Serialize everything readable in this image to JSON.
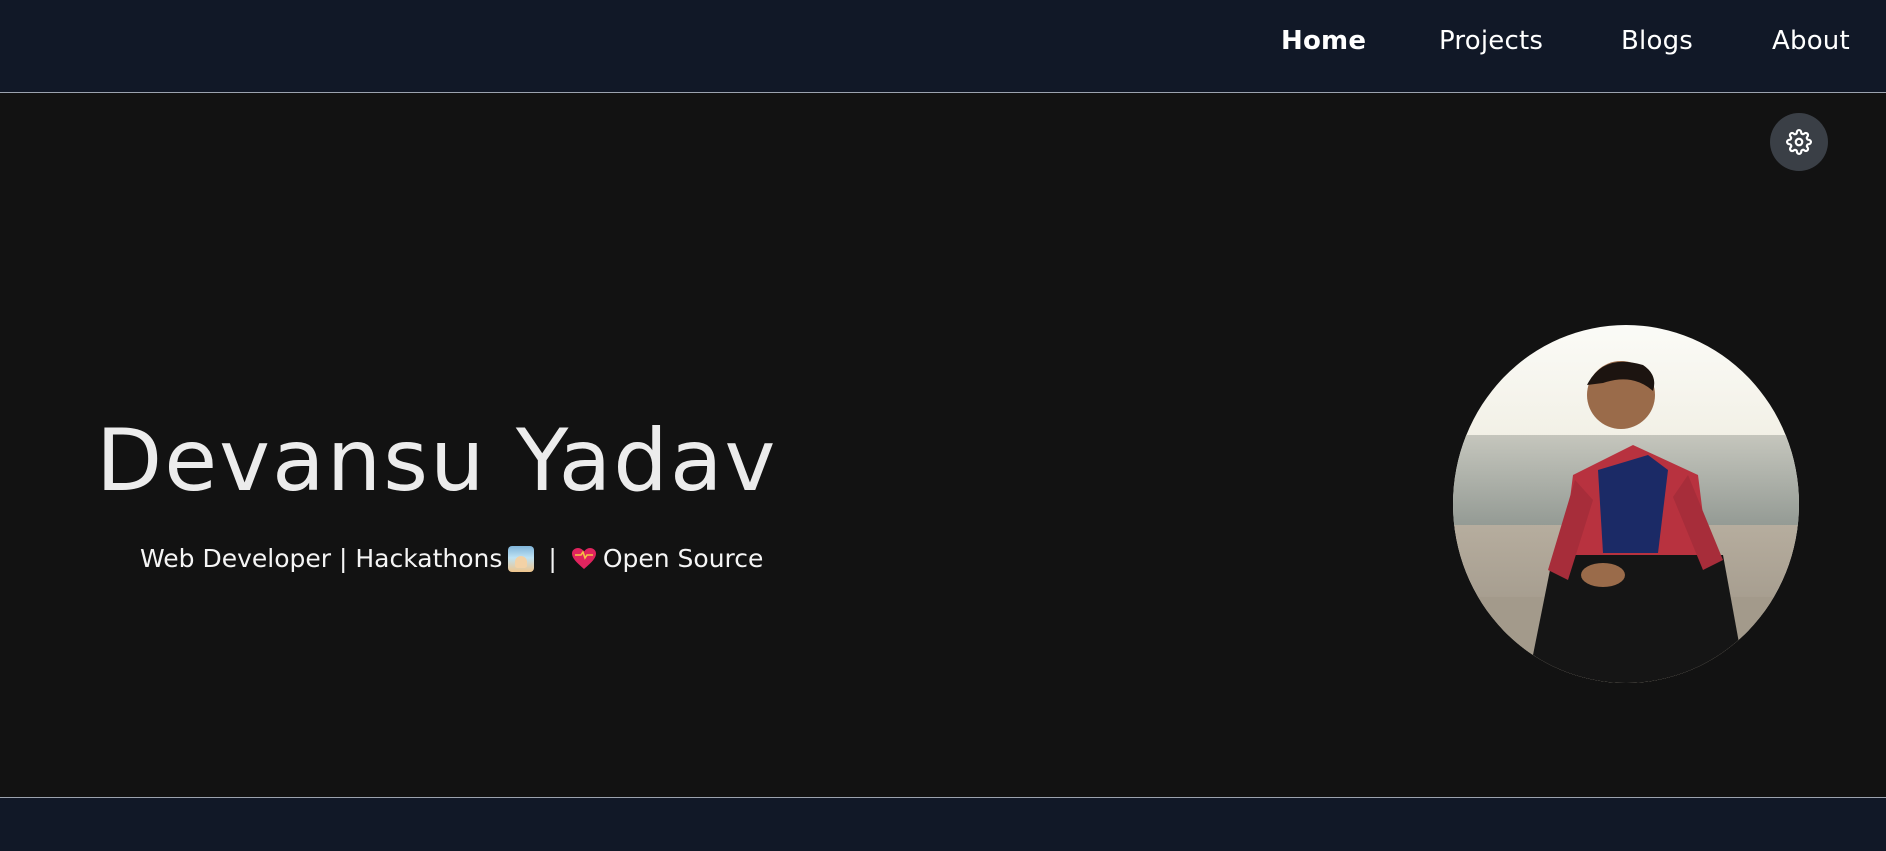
{
  "nav": {
    "items": [
      {
        "label": "Home",
        "active": true
      },
      {
        "label": "Projects",
        "active": false
      },
      {
        "label": "Blogs",
        "active": false
      },
      {
        "label": "About",
        "active": false
      }
    ]
  },
  "settings": {
    "icon": "gear-icon"
  },
  "hero": {
    "name": "Devansu Yadav",
    "tagline_part1": "Web Developer | Hackathons",
    "tagline_sep": "|",
    "tagline_part2": "Open Source",
    "emoji1": "technologist-icon",
    "emoji2": "heart-icon"
  },
  "colors": {
    "nav_bg": "#111827",
    "hero_bg": "#121212",
    "button_bg": "#3a3f46",
    "text": "#ffffff"
  }
}
